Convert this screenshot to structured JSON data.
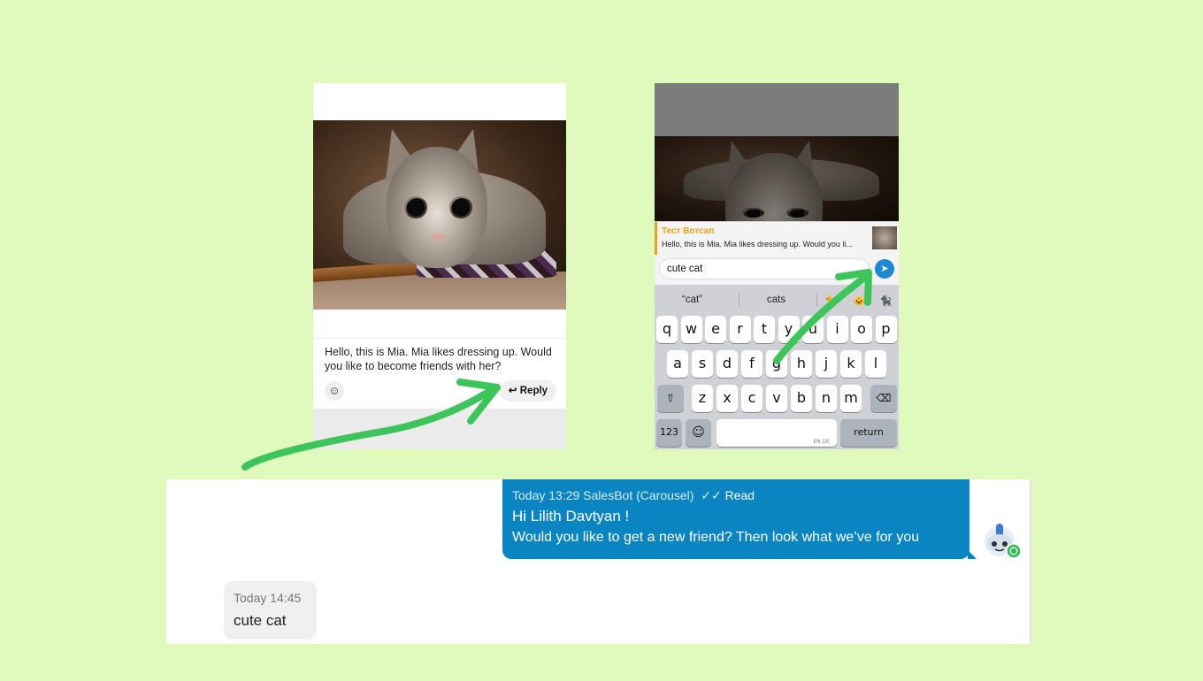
{
  "colors": {
    "background": "#dffabc",
    "arrow": "#3dc45a",
    "bubble_out": "#0a85c2",
    "bubble_in": "#f0f0f0",
    "quote_accent": "#e8a21a",
    "send_button": "#1f88d3"
  },
  "phone_left": {
    "caption": "Hello, this is Mia. Mia likes dressing up. Would you like to become friends with her?",
    "emoji_icon": "emoji-icon",
    "reply_label": "Reply",
    "reply_icon": "reply-arrow-icon"
  },
  "phone_right": {
    "quote_title": "Тест Вотсап",
    "quote_text": "Hello, this is Mia. Mia likes dressing up. Would you li...",
    "input_value": "cute cat",
    "send_icon": "send-icon",
    "suggestions": [
      "“cat”",
      "cats"
    ],
    "suggestion_emojis": [
      "🐈",
      "🐱",
      "🐈‍⬛"
    ],
    "keyboard": {
      "row1": [
        "q",
        "w",
        "e",
        "r",
        "t",
        "y",
        "u",
        "i",
        "o",
        "p"
      ],
      "row2": [
        "a",
        "s",
        "d",
        "f",
        "g",
        "h",
        "j",
        "k",
        "l"
      ],
      "row3": [
        "z",
        "x",
        "c",
        "v",
        "b",
        "n",
        "m"
      ],
      "shift_icon": "shift-icon",
      "backspace_icon": "backspace-icon",
      "numbers_label": "123",
      "emoji_key_icon": "emoji-icon",
      "space_hint": "EN DE",
      "return_label": "return"
    }
  },
  "chat": {
    "outgoing": {
      "meta": "Today 13:29 SalesBot (Carousel)",
      "read_icon": "double-check-icon",
      "read_label": "Read",
      "line1": "Hi Lilith Davtyan !",
      "line2": "Would you like to get a new friend? Then look what we’ve for you"
    },
    "bot_avatar_icon": "robot-avatar-icon",
    "whatsapp_badge_icon": "whatsapp-icon",
    "incoming": {
      "meta": "Today 14:45",
      "text": "cute cat"
    }
  }
}
